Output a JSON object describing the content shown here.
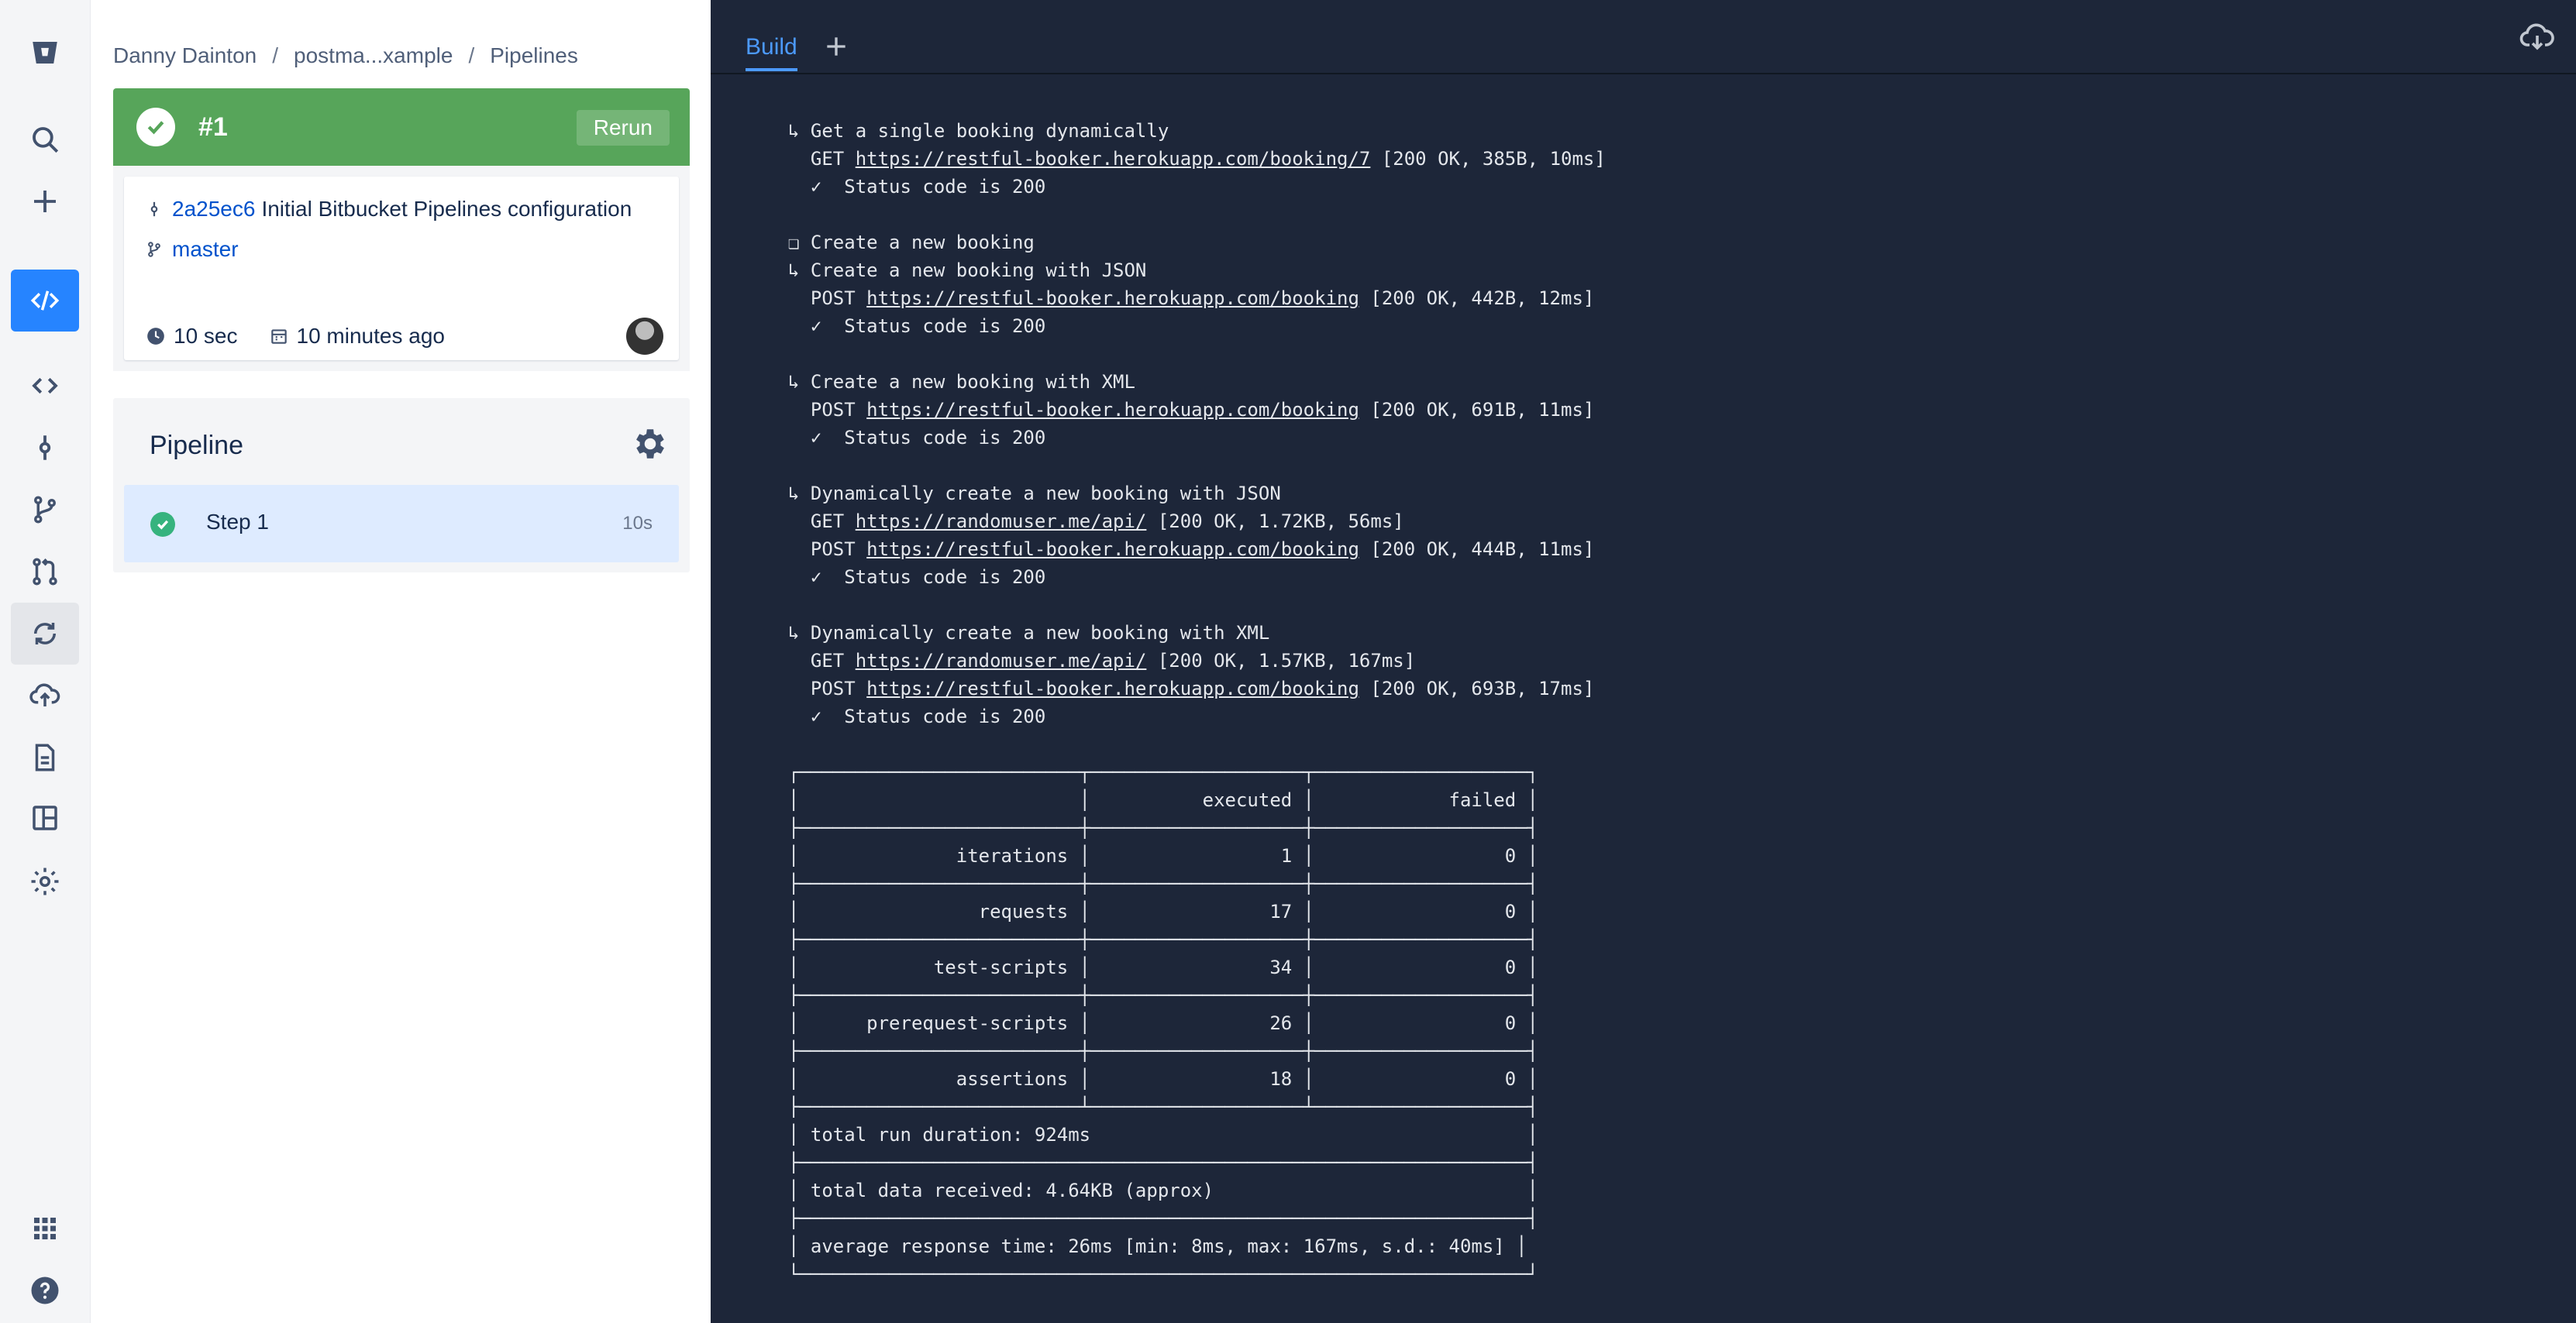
{
  "global_nav": {
    "items": [
      {
        "name": "bitbucket-logo",
        "label": "Bitbucket"
      },
      {
        "name": "search-icon",
        "label": "Search"
      },
      {
        "name": "plus-icon",
        "label": "Create"
      },
      {
        "name": "source-icon",
        "label": "Source"
      },
      {
        "name": "code-icon",
        "label": "Code"
      },
      {
        "name": "commits-icon",
        "label": "Commits"
      },
      {
        "name": "branches-icon",
        "label": "Branches"
      },
      {
        "name": "pull-requests-icon",
        "label": "Pull requests"
      },
      {
        "name": "pipelines-icon",
        "label": "Pipelines"
      },
      {
        "name": "deployments-icon",
        "label": "Deployments"
      },
      {
        "name": "downloads-icon",
        "label": "Downloads"
      },
      {
        "name": "boards-icon",
        "label": "Boards"
      },
      {
        "name": "settings-icon",
        "label": "Settings"
      },
      {
        "name": "app-switcher-icon",
        "label": "Apps"
      },
      {
        "name": "help-icon",
        "label": "Help"
      }
    ],
    "active_color": "#2684ff"
  },
  "breadcrumb": {
    "user": "Danny Dainton",
    "repo": "postma...xample",
    "page": "Pipelines",
    "separator": "/"
  },
  "build": {
    "number": "#1",
    "status": "successful",
    "status_color": "#57a55a",
    "rerun_label": "Rerun",
    "commit_hash": "2a25ec6",
    "commit_message": "Initial Bitbucket Pipelines configuration",
    "branch": "master",
    "duration": "10 sec",
    "started": "10 minutes ago"
  },
  "pipeline": {
    "title": "Pipeline",
    "steps": [
      {
        "name": "Step 1",
        "duration": "10s",
        "status": "successful"
      }
    ]
  },
  "log": {
    "tabs": [
      {
        "label": "Build",
        "active": true
      }
    ],
    "add_tab_label": "+",
    "lines": [
      "↳ Get a single booking dynamically",
      "  GET https://restful-booker.herokuapp.com/booking/7 [200 OK, 385B, 10ms]",
      "  ✓  Status code is 200",
      "",
      "❏ Create a new booking",
      "↳ Create a new booking with JSON",
      "  POST https://restful-booker.herokuapp.com/booking [200 OK, 442B, 12ms]",
      "  ✓  Status code is 200",
      "",
      "↳ Create a new booking with XML",
      "  POST https://restful-booker.herokuapp.com/booking [200 OK, 691B, 11ms]",
      "  ✓  Status code is 200",
      "",
      "↳ Dynamically create a new booking with JSON",
      "  GET https://randomuser.me/api/ [200 OK, 1.72KB, 56ms]",
      "  POST https://restful-booker.herokuapp.com/booking [200 OK, 444B, 11ms]",
      "  ✓  Status code is 200",
      "",
      "↳ Dynamically create a new booking with XML",
      "  GET https://randomuser.me/api/ [200 OK, 1.57KB, 167ms]",
      "  POST https://restful-booker.herokuapp.com/booking [200 OK, 693B, 17ms]",
      "  ✓  Status code is 200",
      "",
      "┌─────────────────────────┬───────────────────┬───────────────────┐",
      "│                         │          executed │            failed │",
      "├─────────────────────────┼───────────────────┼───────────────────┤",
      "│              iterations │                 1 │                 0 │",
      "├─────────────────────────┼───────────────────┼───────────────────┤",
      "│                requests │                17 │                 0 │",
      "├─────────────────────────┼───────────────────┼───────────────────┤",
      "│            test-scripts │                34 │                 0 │",
      "├─────────────────────────┼───────────────────┼───────────────────┤",
      "│      prerequest-scripts │                26 │                 0 │",
      "├─────────────────────────┼───────────────────┼───────────────────┤",
      "│              assertions │                18 │                 0 │",
      "├─────────────────────────┴───────────────────┴───────────────────┤",
      "│ total run duration: 924ms                                       │",
      "├─────────────────────────────────────────────────────────────────┤",
      "│ total data received: 4.64KB (approx)                            │",
      "├─────────────────────────────────────────────────────────────────┤",
      "│ average response time: 26ms [min: 8ms, max: 167ms, s.d.: 40ms] │",
      "└─────────────────────────────────────────────────────────────────┘"
    ],
    "background_color": "#1d2639"
  }
}
